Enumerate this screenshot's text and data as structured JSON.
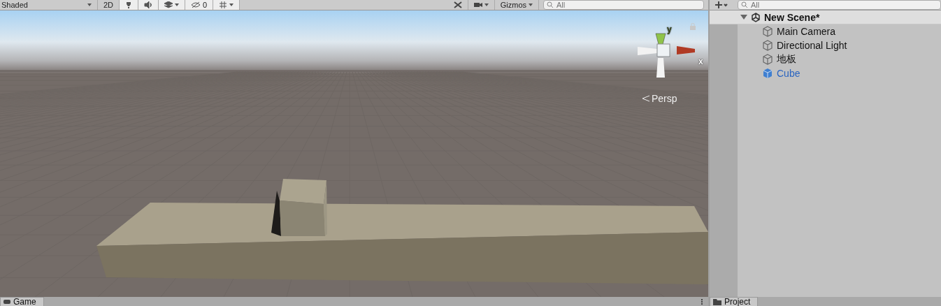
{
  "scene_toolbar": {
    "shading_mode": "Shaded",
    "mode_2d": "2D",
    "hidden_count": "0",
    "gizmos": "Gizmos",
    "toggles": {
      "lighting": true,
      "audio": true,
      "effects": true,
      "hidden_objects": true,
      "grid": true
    },
    "search": {
      "placeholder": "All"
    }
  },
  "viewport": {
    "axes": [
      {
        "label": "y",
        "kind": "y"
      },
      {
        "label": "x",
        "kind": "x"
      }
    ],
    "projection": "Persp"
  },
  "bottom_tabs": [
    {
      "label": "Game"
    }
  ],
  "hierarchy": {
    "search": {
      "placeholder": "All"
    },
    "scene": {
      "name": "New Scene*",
      "expanded": true,
      "children": [
        {
          "name": "Main Camera",
          "kind": "object"
        },
        {
          "name": "Directional Light",
          "kind": "object"
        },
        {
          "name": "地板",
          "kind": "object"
        },
        {
          "name": "Cube",
          "kind": "prefab"
        }
      ]
    }
  },
  "project_tabs": [
    {
      "label": "Project"
    }
  ]
}
